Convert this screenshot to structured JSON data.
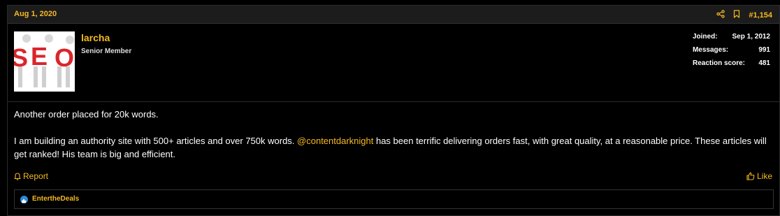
{
  "post": {
    "date": "Aug 1, 2020",
    "number": "#1,154",
    "author": {
      "username": "larcha",
      "title": "Senior Member",
      "avatar_letters": "SEO"
    },
    "stats": [
      {
        "label": "Joined:",
        "value": "Sep 1, 2012"
      },
      {
        "label": "Messages:",
        "value": "991"
      },
      {
        "label": "Reaction score:",
        "value": "481"
      }
    ],
    "body": {
      "line1": "Another order placed for 20k words.",
      "line2_before": "I am building an authority site with 500+ articles and over 750k words. ",
      "mention": "@contentdarknight",
      "line2_after": " has been terrific delivering orders fast, with great quality, at a reasonable price. These articles will get ranked! His team is big and efficient."
    },
    "actions": {
      "report": "Report",
      "like": "Like"
    },
    "reactions": {
      "user": "EntertheDeals"
    }
  },
  "colors": {
    "accent": "#f5b921",
    "background": "#000000",
    "header_bg": "#1c1c1c",
    "reaction_blue": "#2d8bd8"
  }
}
